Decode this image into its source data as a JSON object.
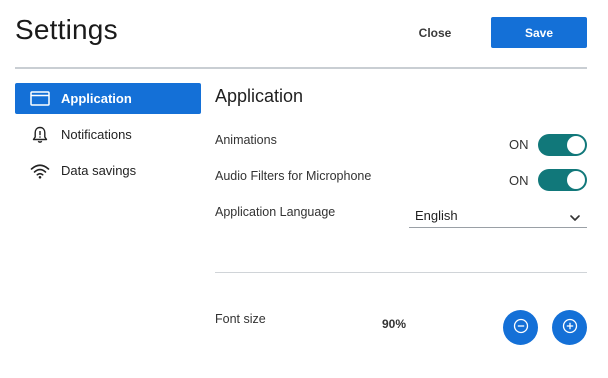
{
  "header": {
    "title": "Settings",
    "close_label": "Close",
    "save_label": "Save"
  },
  "sidebar": {
    "items": [
      {
        "label": "Application",
        "icon": "window-icon",
        "active": true
      },
      {
        "label": "Notifications",
        "icon": "bell-icon",
        "active": false
      },
      {
        "label": "Data savings",
        "icon": "wifi-icon",
        "active": false
      }
    ]
  },
  "main": {
    "section_title": "Application",
    "animations": {
      "label": "Animations",
      "state": "ON"
    },
    "audio_filters": {
      "label": "Audio Filters for Microphone",
      "state": "ON"
    },
    "language": {
      "label": "Application Language",
      "value": "English"
    },
    "font_size": {
      "label": "Font size",
      "value": "90%"
    }
  },
  "colors": {
    "accent": "#1470d7",
    "toggle_on": "#11787a",
    "divider": "#c9ced3"
  }
}
